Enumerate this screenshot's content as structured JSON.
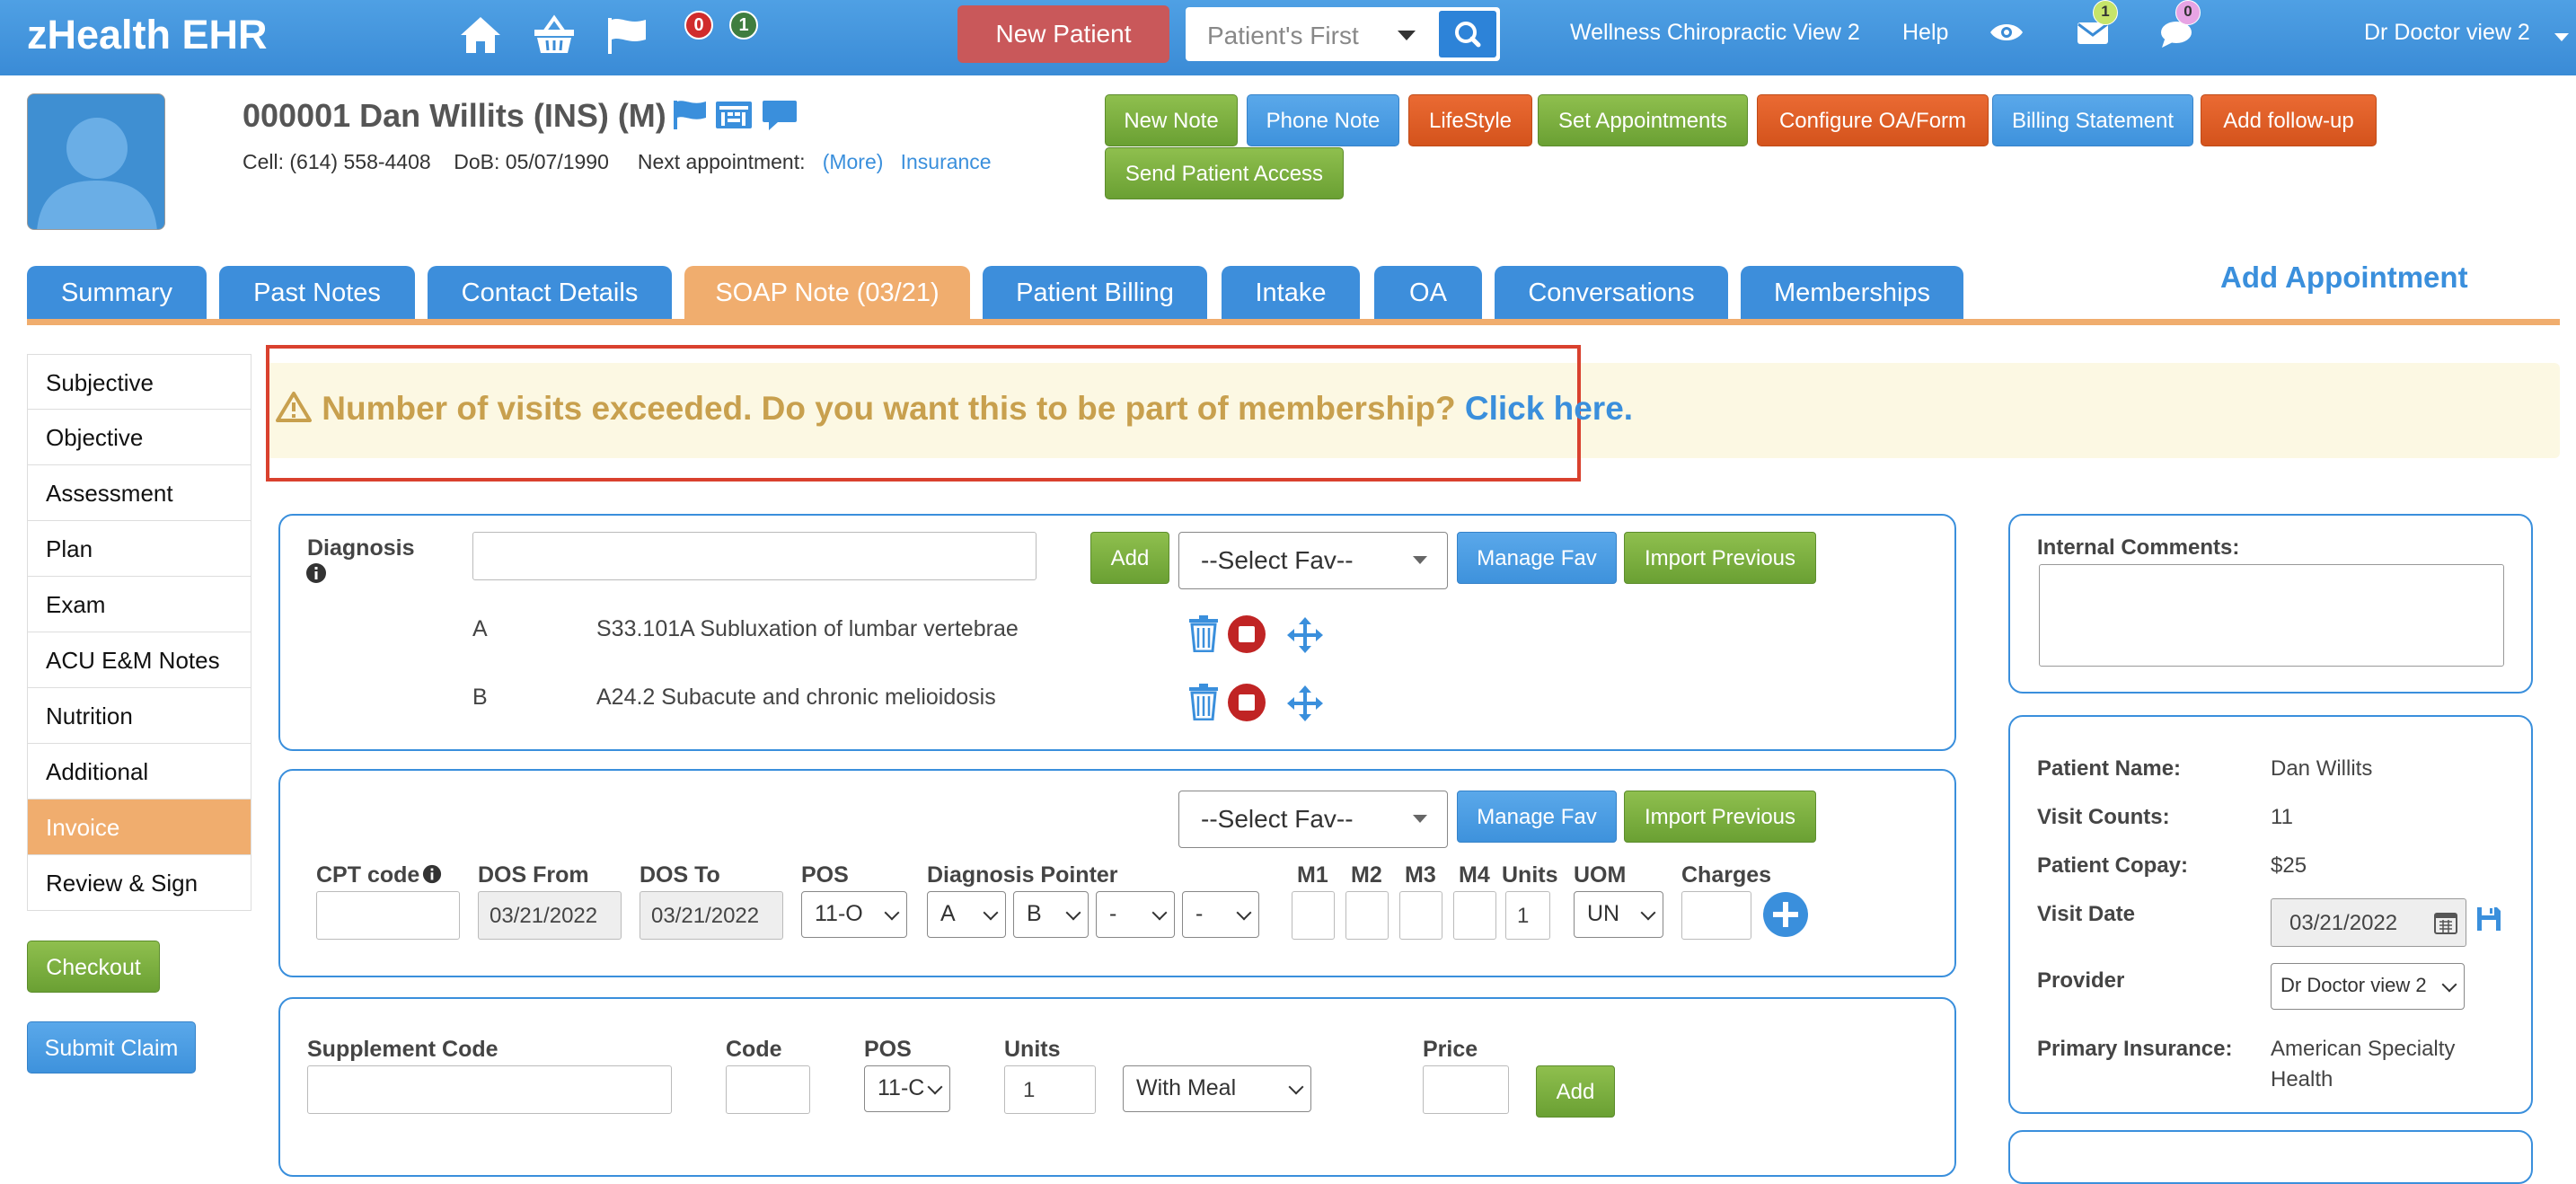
{
  "topbar": {
    "brand": "zHealth EHR",
    "alert_count_red": "0",
    "alert_count_green": "1",
    "new_patient_label": "New Patient",
    "patient_search_placeholder": "Patient's First",
    "clinic_view": "Wellness Chiropractic View 2",
    "help_label": "Help",
    "mail_count": "1",
    "chat_count": "0",
    "user_menu": "Dr Doctor view 2"
  },
  "patient": {
    "title": "000001 Dan Willits  (INS) (M)",
    "cell": "Cell: (614) 558-4408",
    "dob": "DoB: 05/07/1990",
    "next_appt_label": "Next appointment:",
    "more_link": "(More)",
    "insurance_link": "Insurance"
  },
  "actions": [
    {
      "label": "New Note",
      "color": "green"
    },
    {
      "label": "Phone Note",
      "color": "blue"
    },
    {
      "label": "LifeStyle",
      "color": "orange"
    },
    {
      "label": "Set Appointments",
      "color": "green"
    },
    {
      "label": "Configure OA/Form",
      "color": "orange"
    },
    {
      "label": "Billing Statement",
      "color": "blue"
    },
    {
      "label": "Add follow-up",
      "color": "orange"
    },
    {
      "label": "Send Patient Access",
      "color": "green"
    }
  ],
  "tabs": [
    {
      "label": "Summary"
    },
    {
      "label": "Past Notes"
    },
    {
      "label": "Contact Details"
    },
    {
      "label": "SOAP Note (03/21)",
      "active": true
    },
    {
      "label": "Patient Billing"
    },
    {
      "label": "Intake"
    },
    {
      "label": "OA"
    },
    {
      "label": "Conversations"
    },
    {
      "label": "Memberships"
    }
  ],
  "add_appointment": "Add Appointment",
  "sidebar": {
    "items": [
      {
        "label": "Subjective"
      },
      {
        "label": "Objective"
      },
      {
        "label": "Assessment"
      },
      {
        "label": "Plan"
      },
      {
        "label": "Exam"
      },
      {
        "label": "ACU E&M Notes"
      },
      {
        "label": "Nutrition"
      },
      {
        "label": "Additional"
      },
      {
        "label": "Invoice",
        "active": true
      },
      {
        "label": "Review & Sign"
      }
    ],
    "checkout": "Checkout",
    "submit_claim": "Submit Claim"
  },
  "alert": {
    "message": "Number of visits exceeded. Do you want this to be part of membership?",
    "link": "Click here."
  },
  "diagnosis": {
    "label": "Diagnosis",
    "add": "Add",
    "select_fav": "--Select Fav--",
    "manage_fav": "Manage Fav",
    "import_previous": "Import Previous",
    "rows": [
      {
        "letter": "A",
        "code": "S33.101A  Subluxation of lumbar vertebrae"
      },
      {
        "letter": "B",
        "code": "A24.2  Subacute and chronic melioidosis"
      }
    ]
  },
  "cpt": {
    "select_fav": "--Select Fav--",
    "manage_fav": "Manage Fav",
    "import_previous": "Import Previous",
    "headers": {
      "cpt_code": "CPT code",
      "dos_from": "DOS From",
      "dos_to": "DOS To",
      "pos": "POS",
      "diag_pointer": "Diagnosis Pointer",
      "m1": "M1",
      "m2": "M2",
      "m3": "M3",
      "m4": "M4",
      "units": "Units",
      "uom": "UOM",
      "charges": "Charges"
    },
    "dos_from": "03/21/2022",
    "dos_to": "03/21/2022",
    "pos": "11-O",
    "pointers": [
      "A",
      "B",
      "-",
      "-"
    ],
    "units": "1",
    "uom": "UN"
  },
  "supplement": {
    "headers": {
      "supplement_code": "Supplement Code",
      "code": "Code",
      "pos": "POS",
      "units": "Units",
      "price": "Price"
    },
    "pos": "11-C",
    "units": "1",
    "meal": "With Meal",
    "add": "Add"
  },
  "comments": {
    "label": "Internal Comments:"
  },
  "visit": {
    "patient_name_label": "Patient Name:",
    "patient_name": "Dan Willits",
    "visit_counts_label": "Visit Counts:",
    "visit_counts": "11",
    "copay_label": "Patient Copay:",
    "copay": "$25",
    "visit_date_label": "Visit Date",
    "visit_date": "03/21/2022",
    "provider_label": "Provider",
    "provider": "Dr Doctor view 2",
    "insurance_label": "Primary Insurance:",
    "insurance_line1": "American Specialty",
    "insurance_line2": "Health"
  }
}
